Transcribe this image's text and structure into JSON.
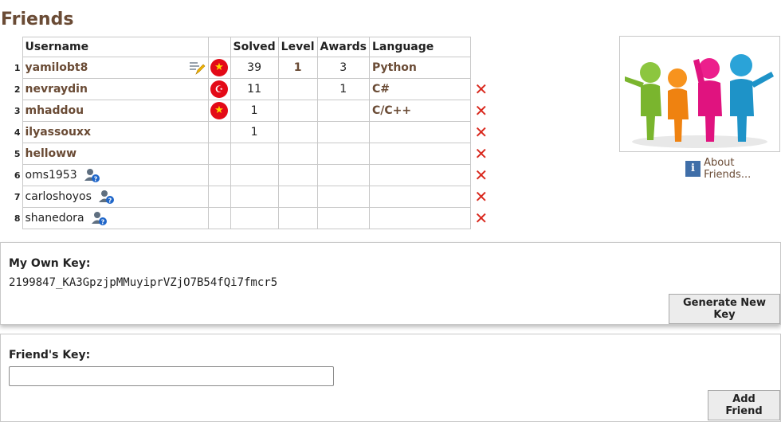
{
  "page": {
    "title": "Friends"
  },
  "table": {
    "headers": {
      "username": "Username",
      "solved": "Solved",
      "level": "Level",
      "awards": "Awards",
      "language": "Language"
    },
    "rows": [
      {
        "index": "1",
        "username": "yamilobt8",
        "flag": "vn",
        "solved": "39",
        "level": "1",
        "awards": "3",
        "language": "Python",
        "deletable": false
      },
      {
        "index": "2",
        "username": "nevraydin",
        "flag": "tr",
        "solved": "11",
        "level": "",
        "awards": "1",
        "language": "C#",
        "deletable": true
      },
      {
        "index": "3",
        "username": "mhaddou",
        "flag": "vn",
        "solved": "1",
        "level": "",
        "awards": "",
        "language": "C/C++",
        "deletable": true
      },
      {
        "index": "4",
        "username": "ilyassouxx",
        "flag": "",
        "solved": "1",
        "level": "",
        "awards": "",
        "language": "",
        "deletable": true
      },
      {
        "index": "5",
        "username": "helloww",
        "flag": "",
        "solved": "",
        "level": "",
        "awards": "",
        "language": "",
        "deletable": true
      },
      {
        "index": "6",
        "username": "oms1953",
        "flag": "",
        "solved": "",
        "level": "",
        "awards": "",
        "language": "",
        "deletable": true
      },
      {
        "index": "7",
        "username": "carloshoyos",
        "flag": "",
        "solved": "",
        "level": "",
        "awards": "",
        "language": "",
        "deletable": true
      },
      {
        "index": "8",
        "username": "shanedora",
        "flag": "",
        "solved": "",
        "level": "",
        "awards": "",
        "language": "",
        "deletable": true
      }
    ],
    "delete_symbol": "✕",
    "icons": {
      "edit": "edit-note-icon",
      "pending": "pending-user-icon",
      "delete": "delete-x-icon"
    }
  },
  "about": {
    "label": "About Friends...",
    "icon_text": "i"
  },
  "my_key": {
    "label": "My Own Key:",
    "value": "2199847_KA3GpzjpMMuyiprVZjO7B54fQi7fmcr5",
    "button": "Generate New Key"
  },
  "friend_key": {
    "label": "Friend's Key:",
    "placeholder": "",
    "button": "Add Friend"
  },
  "colors": {
    "accent": "#6a4b35",
    "delete": "#d9271c",
    "info": "#3f6ea8"
  }
}
